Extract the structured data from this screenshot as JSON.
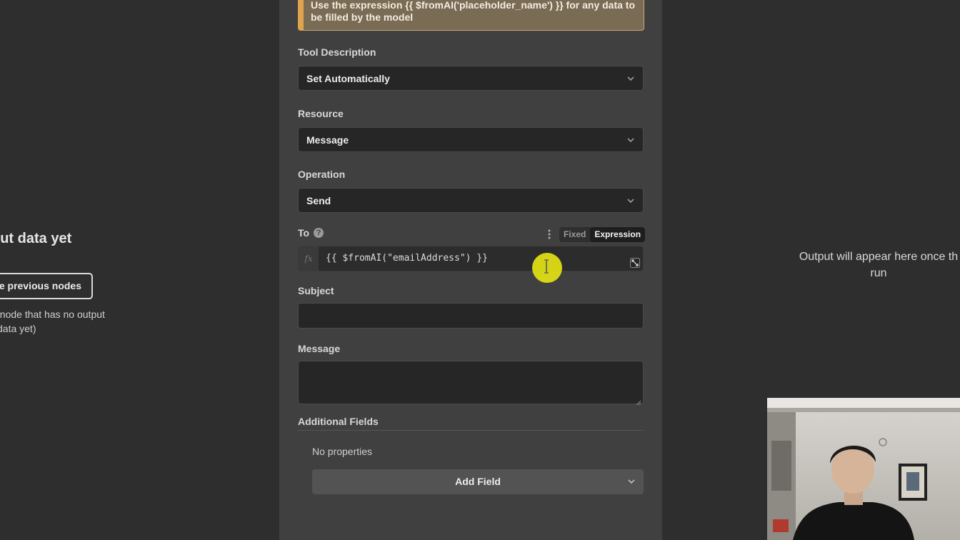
{
  "input_panel": {
    "title": "put data yet",
    "execute_button": "e previous nodes",
    "note_line1": "t node that has no output",
    "note_line2": "data yet)"
  },
  "parameters": {
    "notice": "Use the expression {{ $fromAI('placeholder_name') }} for any data to be filled by the model",
    "tool_description": {
      "label": "Tool Description",
      "value": "Set Automatically"
    },
    "resource": {
      "label": "Resource",
      "value": "Message"
    },
    "operation": {
      "label": "Operation",
      "value": "Send"
    },
    "to": {
      "label": "To",
      "mode_fixed": "Fixed",
      "mode_expression": "Expression",
      "active_mode": "Expression",
      "fx": "fx",
      "expression": "{{ $fromAI(\"emailAddress\") }}"
    },
    "subject": {
      "label": "Subject",
      "value": ""
    },
    "message": {
      "label": "Message",
      "value": ""
    },
    "additional_fields": {
      "title": "Additional Fields",
      "empty_text": "No properties",
      "add_button": "Add Field"
    }
  },
  "output_panel": {
    "line1": "Output will appear here once th",
    "line2": "run"
  },
  "colors": {
    "panel_bg": "#404040",
    "page_bg": "#2e2e2e",
    "input_bg": "#262626",
    "notice_accent": "#e0a34e",
    "cursor_highlight": "#e4e214"
  },
  "icons": [
    "help-icon",
    "chevron-down-icon",
    "more-vertical-icon",
    "expand-icon",
    "text-cursor-icon",
    "resize-grip-icon"
  ]
}
